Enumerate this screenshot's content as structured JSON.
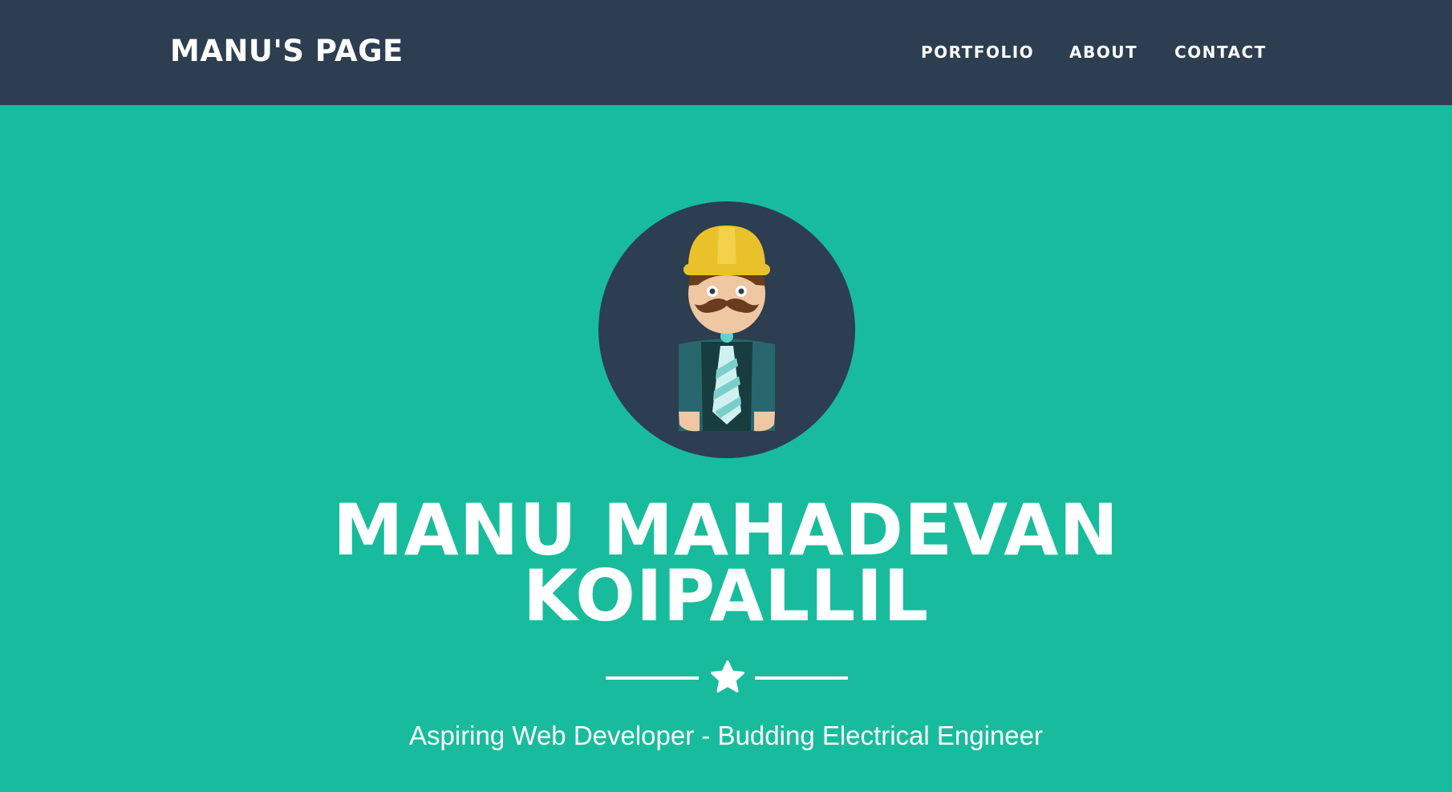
{
  "navbar": {
    "brand": "MANU'S PAGE",
    "links": [
      "PORTFOLIO",
      "ABOUT",
      "CONTACT"
    ]
  },
  "hero": {
    "name_line1": "MANU MAHADEVAN",
    "name_line2": "KOIPALLIL",
    "tagline": "Aspiring Web Developer - Budding Electrical Engineer",
    "avatar_icon": "engineer-avatar-icon",
    "divider_icon": "star-icon"
  },
  "colors": {
    "navbar_bg": "#2C3E50",
    "hero_bg": "#18BC9C",
    "text": "#FFFFFF",
    "helmet": "#E9C22B",
    "jacket": "#28666E",
    "tie": "#CFF2F0"
  }
}
